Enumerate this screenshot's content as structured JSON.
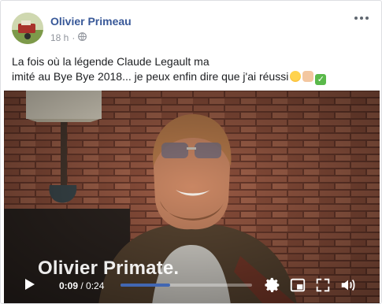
{
  "post": {
    "author": "Olivier Primeau",
    "time": "18 h",
    "separator": "·",
    "caption_line1": "La fois où la légende Claude Legault ma",
    "caption_line2": "imité au Bye Bye 2018... je peux enfin dire que j'ai réussi"
  },
  "video": {
    "overlay_text": "Olivier Primate.",
    "current_time": "0:09",
    "duration": "0:24",
    "progress": 0.375
  },
  "icons": {
    "more": "more-options-icon",
    "privacy": "globe-icon",
    "play": "play-icon",
    "settings": "gear-icon",
    "pip": "picture-in-picture-icon",
    "fullscreen": "fullscreen-icon",
    "volume": "volume-icon"
  },
  "colors": {
    "author_link": "#385898",
    "progress": "#4267b2",
    "meta": "#90949c"
  }
}
